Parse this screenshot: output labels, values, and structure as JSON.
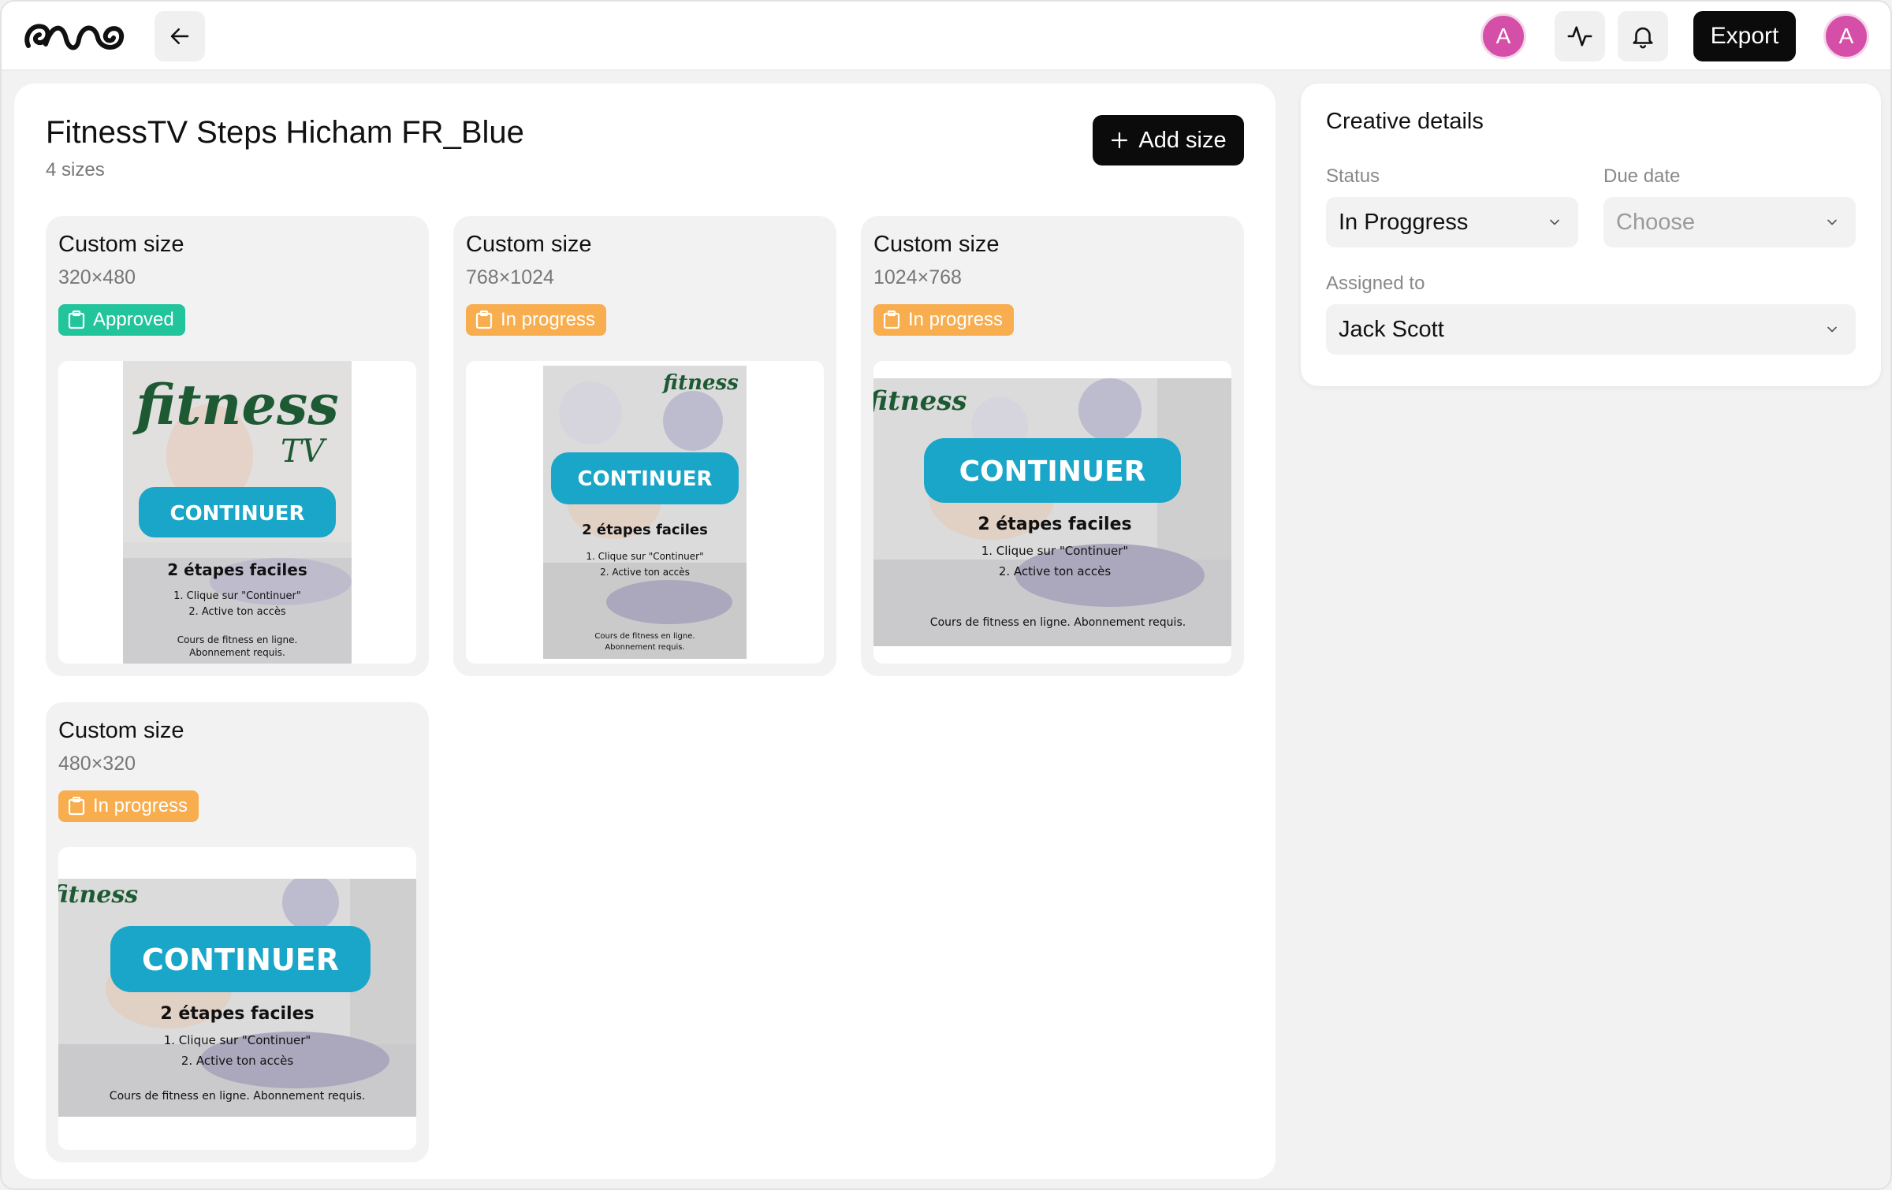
{
  "header": {
    "back_icon": "arrow-left-icon",
    "user_initial": "A",
    "activity_icon": "activity-icon",
    "bell_icon": "bell-icon",
    "export_label": "Export",
    "profile_initial": "A"
  },
  "project": {
    "title": "FitnessTV Steps Hicham FR_Blue",
    "size_count": "4 sizes",
    "add_size_label": "Add size"
  },
  "cards": [
    {
      "title": "Custom size",
      "dims": "320×480",
      "status": "Approved",
      "status_color": "#22c49b"
    },
    {
      "title": "Custom size",
      "dims": "768×1024",
      "status": "In progress",
      "status_color": "#f8ad4e"
    },
    {
      "title": "Custom size",
      "dims": "1024×768",
      "status": "In progress",
      "status_color": "#f8ad4e"
    },
    {
      "title": "Custom size",
      "dims": "480×320",
      "status": "In progress",
      "status_color": "#f8ad4e"
    }
  ],
  "creative": {
    "logo_text": "fitness",
    "logo_sub": "TV",
    "cta": "CONTINUER",
    "heading": "2 étapes faciles",
    "step1": "1. Clique sur \"Continuer\"",
    "step2": "2. Active ton accès",
    "footer_a": "Cours de fitness en ligne.",
    "footer_b": "Abonnement requis.",
    "footer_full": "Cours de fitness en ligne. Abonnement requis."
  },
  "details": {
    "title": "Creative details",
    "status_label": "Status",
    "status_value": "In Proggress",
    "due_label": "Due date",
    "due_placeholder": "Choose",
    "assigned_label": "Assigned to",
    "assigned_value": "Jack Scott"
  },
  "colors": {
    "accent_dark": "#0b0b0b",
    "avatar": "#d54fa8",
    "approved": "#22c49b",
    "in_progress": "#f8ad4e",
    "cta": "#1aa6c8"
  }
}
